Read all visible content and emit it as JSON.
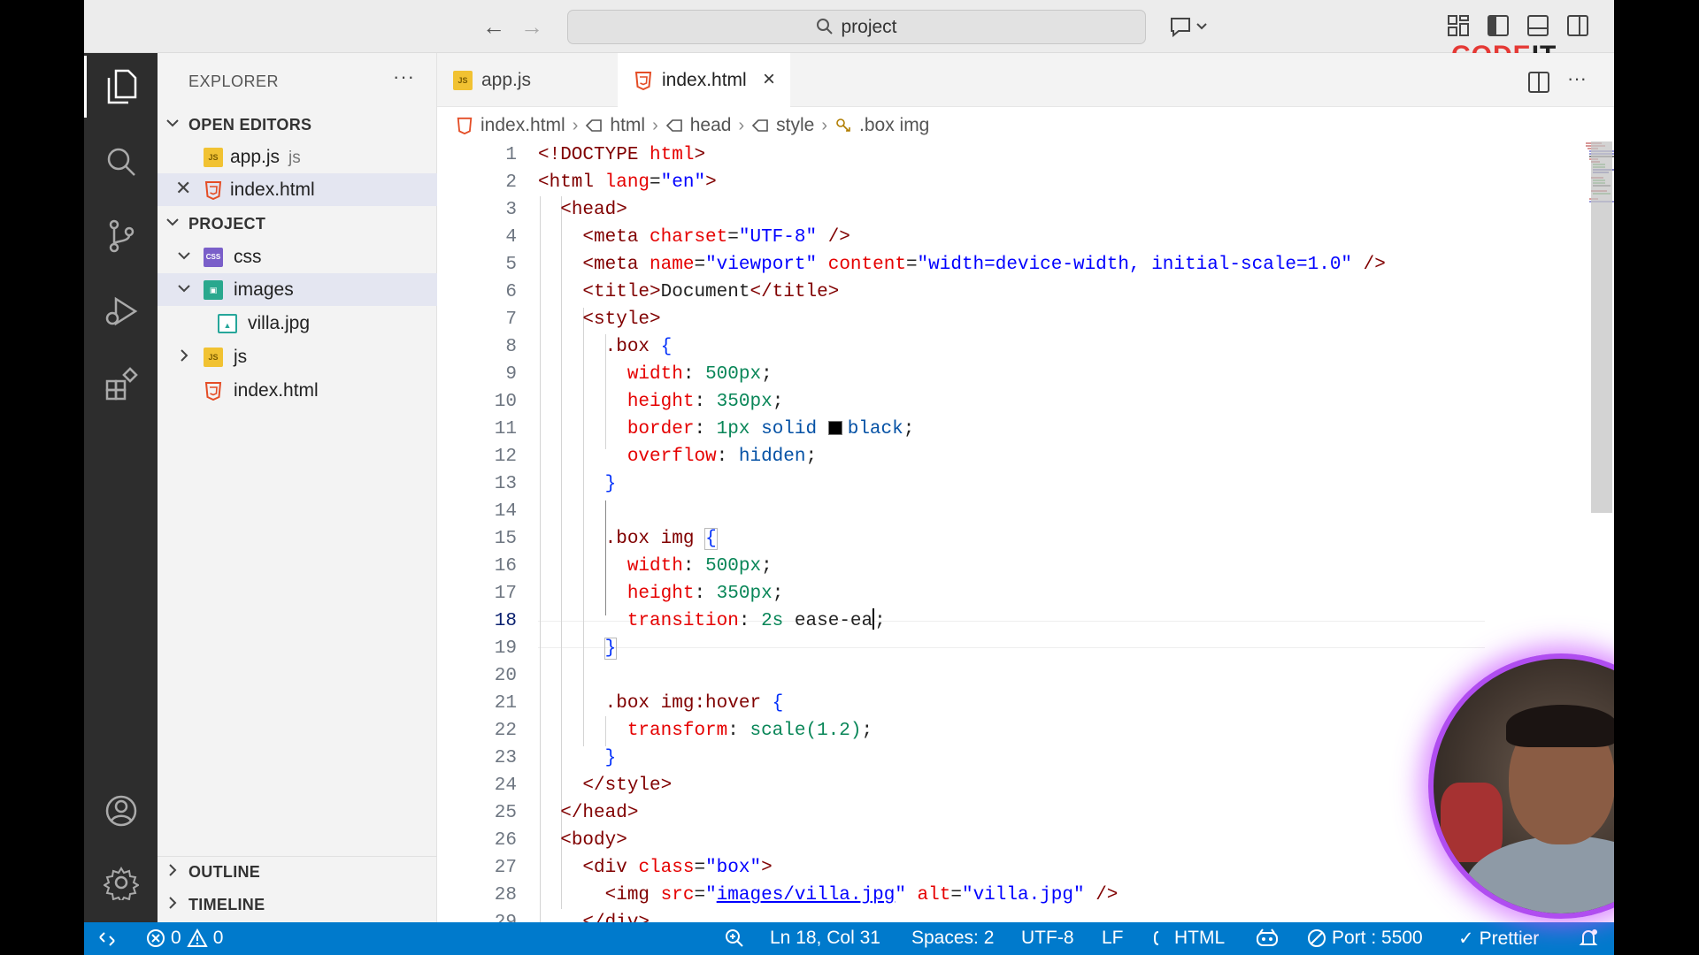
{
  "title_bar": {
    "search": "project",
    "logo_part1": "CODE",
    "logo_part2": "IT"
  },
  "sidebar": {
    "title": "EXPLORER",
    "more": "···",
    "open_editors_header": "OPEN EDITORS",
    "open_editors": [
      {
        "name": "app.js",
        "hint": "js"
      },
      {
        "name": "index.html",
        "hint": ""
      }
    ],
    "project_header": "PROJECT",
    "tree": [
      {
        "name": "css"
      },
      {
        "name": "images"
      },
      {
        "name": "villa.jpg"
      },
      {
        "name": "js"
      },
      {
        "name": "index.html"
      }
    ],
    "outline_header": "OUTLINE",
    "timeline_header": "TIMELINE"
  },
  "tabs": [
    {
      "label": "app.js"
    },
    {
      "label": "index.html"
    }
  ],
  "breadcrumb": [
    "index.html",
    "html",
    "head",
    "style",
    ".box img"
  ],
  "editor": {
    "current_line": 18
  },
  "status_bar": {
    "errors": "0",
    "warnings": "0",
    "position": "Ln 18, Col 31",
    "spaces": "Spaces: 2",
    "encoding": "UTF-8",
    "eol": "LF",
    "language": "HTML",
    "port": "Port : 5500",
    "formatter": "Prettier"
  },
  "colors": {
    "status_bar": "#007acc",
    "activity_bar": "#2d2d2d",
    "sidebar": "#f3f3f3",
    "webcam_ring": "#b04df0"
  }
}
